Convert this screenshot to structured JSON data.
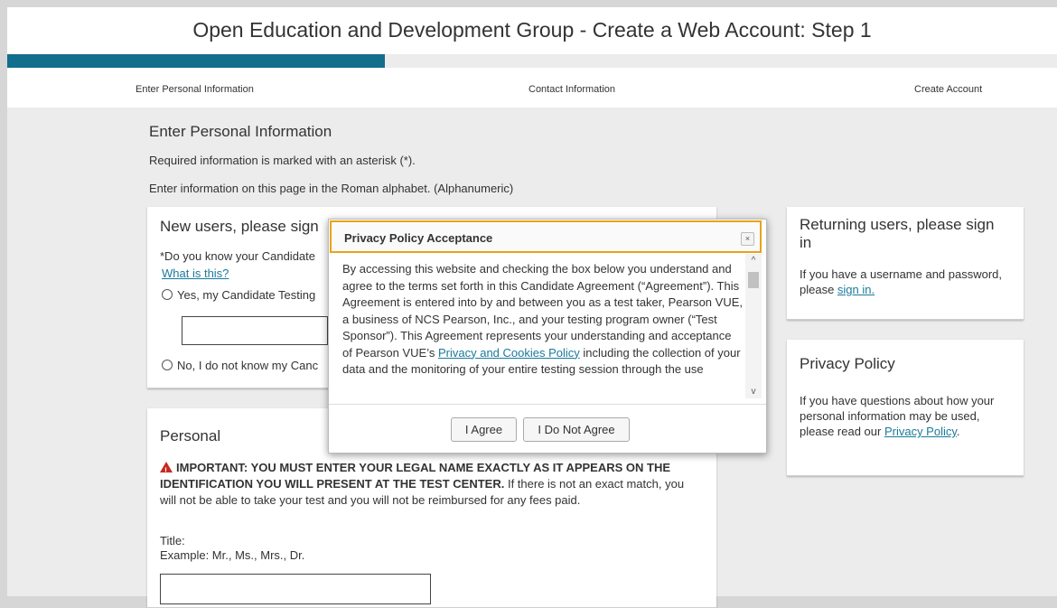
{
  "header": {
    "title": "Open Education and Development Group - Create a Web Account: Step 1"
  },
  "progress": {
    "fraction": 0.36
  },
  "steps": [
    "Enter Personal Information",
    "Contact Information",
    "Create Account"
  ],
  "main": {
    "heading": "Enter Personal Information",
    "required_note": "Required information is marked with an asterisk (*).",
    "roman_note": "Enter information on this page in the Roman alphabet. (Alphanumeric)"
  },
  "new_users": {
    "title": "New users, please sign",
    "question": "*Do you know your Candidate",
    "what_is_this": "What is this?",
    "yes_option": "Yes, my Candidate Testing",
    "no_option": "No, I do not know my Canc"
  },
  "personal": {
    "title": "Personal",
    "important_bold": "IMPORTANT: YOU MUST ENTER YOUR LEGAL NAME EXACTLY AS IT APPEARS ON THE IDENTIFICATION YOU WILL PRESENT AT THE TEST CENTER.",
    "important_rest": " If there is not an exact match, you will not be able to take your test and you will not be reimbursed for any fees paid.",
    "title_label": "Title:",
    "title_example": "Example: Mr., Ms., Mrs., Dr."
  },
  "returning": {
    "title": "Returning users, please sign in",
    "text": "If you have a username and password, please ",
    "link": "sign in."
  },
  "privacy_card": {
    "title": "Privacy Policy",
    "text": "If you have questions about how your personal information may be used, please read our ",
    "link": "Privacy Policy",
    "end": "."
  },
  "modal": {
    "title": "Privacy Policy Acceptance",
    "close": "×",
    "body_part1": "By accessing this website and checking the box below you understand and agree to the terms set forth in this Candidate Agreement (“Agreement”). This Agreement is entered into by and between you as a test taker, Pearson VUE, a business of NCS Pearson, Inc., and your testing program owner (“Test Sponsor”). This Agreement represents your understanding and acceptance of Pearson VUE’s ",
    "body_link": "Privacy and Cookies Policy",
    "body_part2": " including the collection of your data and the monitoring of your entire testing session through the use",
    "agree": "I Agree",
    "disagree": "I Do Not Agree",
    "scroll_up": "^",
    "scroll_down": "v"
  }
}
